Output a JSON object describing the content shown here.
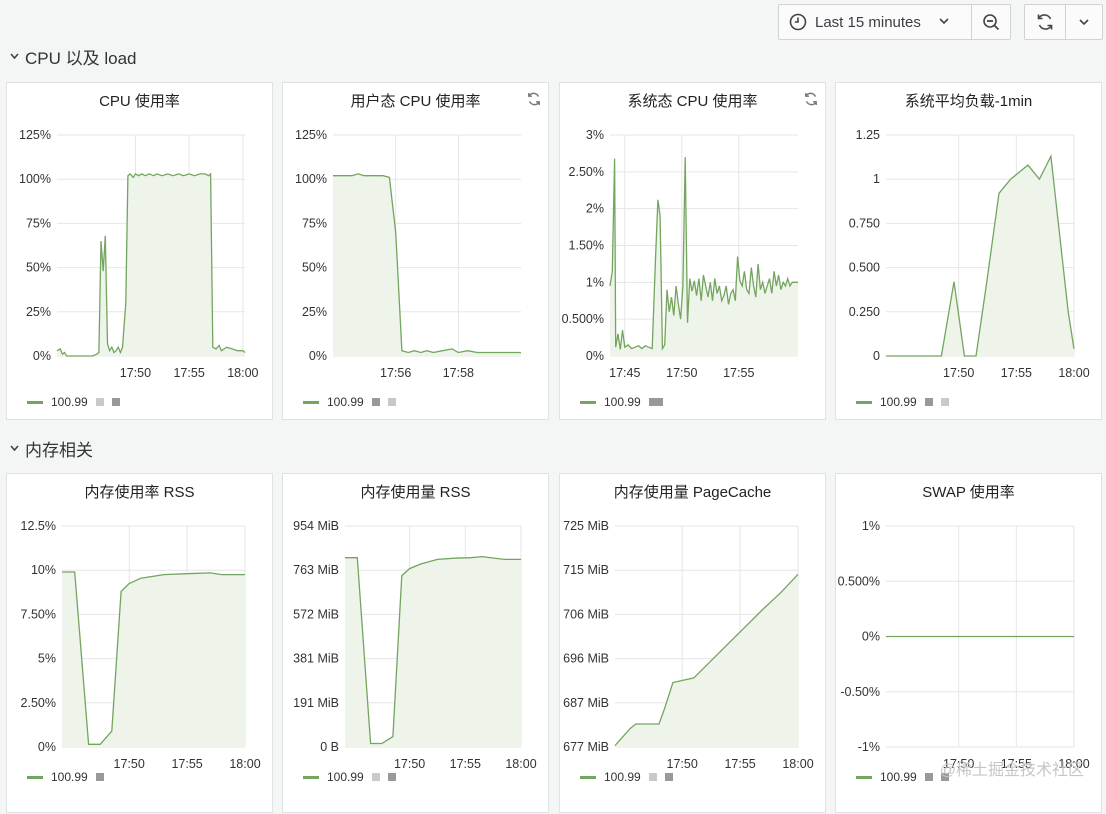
{
  "toolbar": {
    "time_range": "Last 15 minutes",
    "icons": [
      "clock-icon",
      "chevron-down-icon",
      "zoom-out-icon",
      "refresh-icon",
      "chevron-down-icon"
    ]
  },
  "rows": [
    {
      "title": "CPU 以及 load"
    },
    {
      "title": "内存相关"
    }
  ],
  "colors": {
    "line": "#73a55f",
    "fill": "#eef4ea",
    "grid": "#e6e6e6"
  },
  "watermark": "@稀土掘金技术社区",
  "panels": [
    {
      "title": "CPU 使用率",
      "has_refresh_icon": false,
      "legend": "100.99",
      "chart_data": {
        "type": "area",
        "y_ticks": [
          "125%",
          "100%",
          "75%",
          "50%",
          "25%",
          "0%"
        ],
        "ylim": [
          0,
          125
        ],
        "x_ticks": [
          {
            "v": 5,
            "label": "17:50"
          },
          {
            "v": 10,
            "label": "17:55"
          },
          {
            "v": 15,
            "label": "18:00"
          }
        ],
        "xlim": [
          -2.3,
          15.2
        ],
        "x": [
          -2.3,
          -2.0,
          -1.8,
          -1.6,
          -1.4,
          1.0,
          1.4,
          1.6,
          1.8,
          2.0,
          2.2,
          2.4,
          2.6,
          2.8,
          3.0,
          3.2,
          3.4,
          3.6,
          3.8,
          4.1,
          4.3,
          4.5,
          4.8,
          5.0,
          5.3,
          5.6,
          5.9,
          6.3,
          6.7,
          7.0,
          7.5,
          8.0,
          8.5,
          9.0,
          9.5,
          10.0,
          10.5,
          11.0,
          11.5,
          11.8,
          12.0,
          12.2,
          12.5,
          12.8,
          13.0,
          13.5,
          14.0,
          14.5,
          15.0,
          15.2
        ],
        "y": [
          3,
          4,
          1,
          2,
          0,
          0,
          1,
          2,
          65,
          48,
          68,
          7,
          3,
          5,
          2,
          3,
          5,
          2,
          5,
          30,
          102,
          103,
          101,
          103,
          102,
          103,
          102,
          103,
          102,
          103,
          102,
          103,
          102,
          103,
          102,
          103,
          102,
          103,
          103,
          102,
          103,
          5,
          4,
          6,
          3,
          5,
          4,
          3,
          3,
          2
        ]
      }
    },
    {
      "title": "用户态 CPU 使用率",
      "has_refresh_icon": true,
      "legend": "100.99",
      "chart_data": {
        "type": "area",
        "y_ticks": [
          "125%",
          "100%",
          "75%",
          "50%",
          "25%",
          "0%"
        ],
        "ylim": [
          0,
          125
        ],
        "x_ticks": [
          {
            "v": 56,
            "label": "17:56"
          },
          {
            "v": 58,
            "label": "17:58"
          }
        ],
        "xlim": [
          54.0,
          60.0
        ],
        "x": [
          54.0,
          54.3,
          54.6,
          54.8,
          55.0,
          55.2,
          55.4,
          55.6,
          55.8,
          56.0,
          56.2,
          56.4,
          56.6,
          56.8,
          57.0,
          57.2,
          57.5,
          57.8,
          58.0,
          58.3,
          58.6,
          59.0,
          59.5,
          60.0
        ],
        "y": [
          102,
          102,
          102,
          103,
          102,
          102,
          102,
          102,
          101,
          70,
          3,
          2,
          3,
          2,
          3,
          2,
          3,
          4,
          2,
          3,
          2,
          2,
          2,
          2
        ]
      }
    },
    {
      "title": "系统态 CPU 使用率",
      "has_refresh_icon": true,
      "legend": "100.99",
      "chart_data": {
        "type": "area",
        "y_ticks": [
          "3%",
          "2.50%",
          "2%",
          "1.50%",
          "1%",
          "0.500%",
          "0%"
        ],
        "ylim": [
          0,
          3
        ],
        "x_ticks": [
          {
            "v": 0,
            "label": "17:45"
          },
          {
            "v": 5,
            "label": "17:50"
          },
          {
            "v": 10,
            "label": "17:55"
          }
        ],
        "xlim": [
          -1.3,
          15.2
        ],
        "x": [
          -1.3,
          -1.1,
          -0.9,
          -0.8,
          -0.6,
          -0.4,
          -0.2,
          0.0,
          0.3,
          0.6,
          0.9,
          1.2,
          1.5,
          1.8,
          2.1,
          2.4,
          2.7,
          2.9,
          3.1,
          3.3,
          3.5,
          3.7,
          3.9,
          4.1,
          4.3,
          4.5,
          4.7,
          4.9,
          5.1,
          5.3,
          5.5,
          5.7,
          5.9,
          6.1,
          6.3,
          6.5,
          6.7,
          6.9,
          7.1,
          7.3,
          7.5,
          7.7,
          7.9,
          8.1,
          8.3,
          8.5,
          8.7,
          8.9,
          9.1,
          9.3,
          9.5,
          9.7,
          9.9,
          10.1,
          10.3,
          10.5,
          10.7,
          10.9,
          11.1,
          11.3,
          11.5,
          11.7,
          11.9,
          12.1,
          12.3,
          12.5,
          12.7,
          12.9,
          13.1,
          13.3,
          13.5,
          13.7,
          13.9,
          14.1,
          14.3,
          14.5,
          14.7,
          14.9,
          15.2
        ],
        "y": [
          0.95,
          1.15,
          2.68,
          0.12,
          0.3,
          0.09,
          0.35,
          0.12,
          0.15,
          0.1,
          0.12,
          0.14,
          0.1,
          0.14,
          0.12,
          0.1,
          1.35,
          2.12,
          1.9,
          0.1,
          0.15,
          0.9,
          0.6,
          0.8,
          0.55,
          0.95,
          0.7,
          0.5,
          0.95,
          2.7,
          0.45,
          1.05,
          0.88,
          1.02,
          0.82,
          1.05,
          0.75,
          1.1,
          0.95,
          0.8,
          1.0,
          0.75,
          1.05,
          0.85,
          0.95,
          0.75,
          0.82,
          0.95,
          0.7,
          0.85,
          0.9,
          0.75,
          1.35,
          1.02,
          0.95,
          1.15,
          0.9,
          0.85,
          1.2,
          0.95,
          0.8,
          1.25,
          0.9,
          1.0,
          0.85,
          0.95,
          1.05,
          0.85,
          1.15,
          0.95,
          1.1,
          0.9,
          1.0,
          0.95,
          1.05,
          0.95,
          1.0,
          1.0,
          1.0
        ]
      }
    },
    {
      "title": "系统平均负载-1min",
      "has_refresh_icon": false,
      "legend": "100.99",
      "chart_data": {
        "type": "area",
        "y_ticks": [
          "1.25",
          "1",
          "0.750",
          "0.500",
          "0.250",
          "0"
        ],
        "ylim": [
          0,
          1.25
        ],
        "x_ticks": [
          {
            "v": 5,
            "label": "17:50"
          },
          {
            "v": 10,
            "label": "17:55"
          },
          {
            "v": 15,
            "label": "18:00"
          }
        ],
        "xlim": [
          -1.3,
          15.0
        ],
        "x": [
          -1.3,
          3.5,
          4.6,
          5.5,
          6.5,
          7.4,
          8.5,
          9.5,
          11.0,
          12.0,
          13.0,
          14.5,
          15.0
        ],
        "y": [
          0,
          0,
          0.42,
          0,
          0,
          0.4,
          0.92,
          1.0,
          1.08,
          1.0,
          1.13,
          0.25,
          0.04
        ]
      }
    },
    {
      "title": "内存使用率 RSS",
      "has_refresh_icon": false,
      "legend": "100.99",
      "chart_data": {
        "type": "area",
        "y_ticks": [
          "12.5%",
          "10%",
          "7.50%",
          "5%",
          "2.50%",
          "0%"
        ],
        "ylim": [
          0,
          12.5
        ],
        "x_ticks": [
          {
            "v": 5,
            "label": "17:50"
          },
          {
            "v": 10,
            "label": "17:55"
          },
          {
            "v": 15,
            "label": "18:00"
          }
        ],
        "xlim": [
          -0.8,
          15.0
        ],
        "x": [
          -0.8,
          0.3,
          1.5,
          2.5,
          3.5,
          4.3,
          5.0,
          6.0,
          8.0,
          10.0,
          12.0,
          13.0,
          15.0
        ],
        "y": [
          9.9,
          9.9,
          0.15,
          0.15,
          0.9,
          8.8,
          9.25,
          9.55,
          9.75,
          9.8,
          9.85,
          9.75,
          9.75
        ]
      }
    },
    {
      "title": "内存使用量 RSS",
      "has_refresh_icon": false,
      "legend": "100.99",
      "chart_data": {
        "type": "area",
        "y_ticks": [
          "954 MiB",
          "763 MiB",
          "572 MiB",
          "381 MiB",
          "191 MiB",
          "0 B"
        ],
        "ylim": [
          0,
          954
        ],
        "x_ticks": [
          {
            "v": 5,
            "label": "17:50"
          },
          {
            "v": 10,
            "label": "17:55"
          },
          {
            "v": 15,
            "label": "18:00"
          }
        ],
        "xlim": [
          -0.8,
          15.0
        ],
        "x": [
          -0.8,
          0.3,
          1.5,
          2.5,
          3.5,
          4.3,
          5.0,
          6.0,
          7.5,
          9.0,
          10.5,
          11.5,
          13.5,
          15.0
        ],
        "y": [
          817,
          817,
          15,
          15,
          45,
          740,
          770,
          790,
          810,
          815,
          817,
          822,
          810,
          810
        ]
      }
    },
    {
      "title": "内存使用量 PageCache",
      "has_refresh_icon": false,
      "legend": "100.99",
      "chart_data": {
        "type": "area",
        "y_ticks": [
          "725 MiB",
          "715 MiB",
          "706 MiB",
          "696 MiB",
          "687 MiB",
          "677 MiB"
        ],
        "ylim": [
          677,
          725
        ],
        "x_ticks": [
          {
            "v": 5,
            "label": "17:50"
          },
          {
            "v": 10,
            "label": "17:55"
          },
          {
            "v": 15,
            "label": "18:00"
          }
        ],
        "xlim": [
          -0.8,
          15.0
        ],
        "x": [
          -0.8,
          0.5,
          1.0,
          3.0,
          3.5,
          4.2,
          6.0,
          8.0,
          10.0,
          12.0,
          13.5,
          15.0
        ],
        "y": [
          677.3,
          681.0,
          682.0,
          682.0,
          685.5,
          691.0,
          692.0,
          697.0,
          702.0,
          707.0,
          710.5,
          714.5
        ]
      }
    },
    {
      "title": "SWAP 使用率",
      "has_refresh_icon": false,
      "legend": "100.99",
      "chart_data": {
        "type": "line",
        "y_ticks": [
          "1%",
          "0.500%",
          "0%",
          "-0.50%",
          "-1%"
        ],
        "ylim": [
          -1,
          1
        ],
        "x_ticks": [
          {
            "v": 5,
            "label": "17:50"
          },
          {
            "v": 10,
            "label": "17:55"
          },
          {
            "v": 15,
            "label": "18:00"
          }
        ],
        "xlim": [
          -1.3,
          15.0
        ],
        "x": [
          -1.3,
          15.0
        ],
        "y": [
          0,
          0
        ]
      }
    }
  ]
}
